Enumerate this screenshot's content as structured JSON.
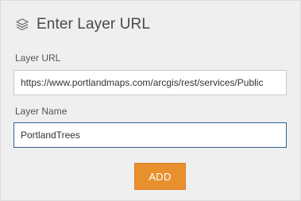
{
  "header": {
    "icon": "layers-icon",
    "title": "Enter Layer URL"
  },
  "form": {
    "layer_url_label": "Layer URL",
    "layer_url_value": "https://www.portlandmaps.com/arcgis/rest/services/Public",
    "layer_name_label": "Layer Name",
    "layer_name_value": "PortlandTrees"
  },
  "actions": {
    "add_label": "ADD"
  },
  "colors": {
    "panel_background": "#efefef",
    "accent_button": "#e8902e",
    "focused_border": "#2e5f8f"
  }
}
